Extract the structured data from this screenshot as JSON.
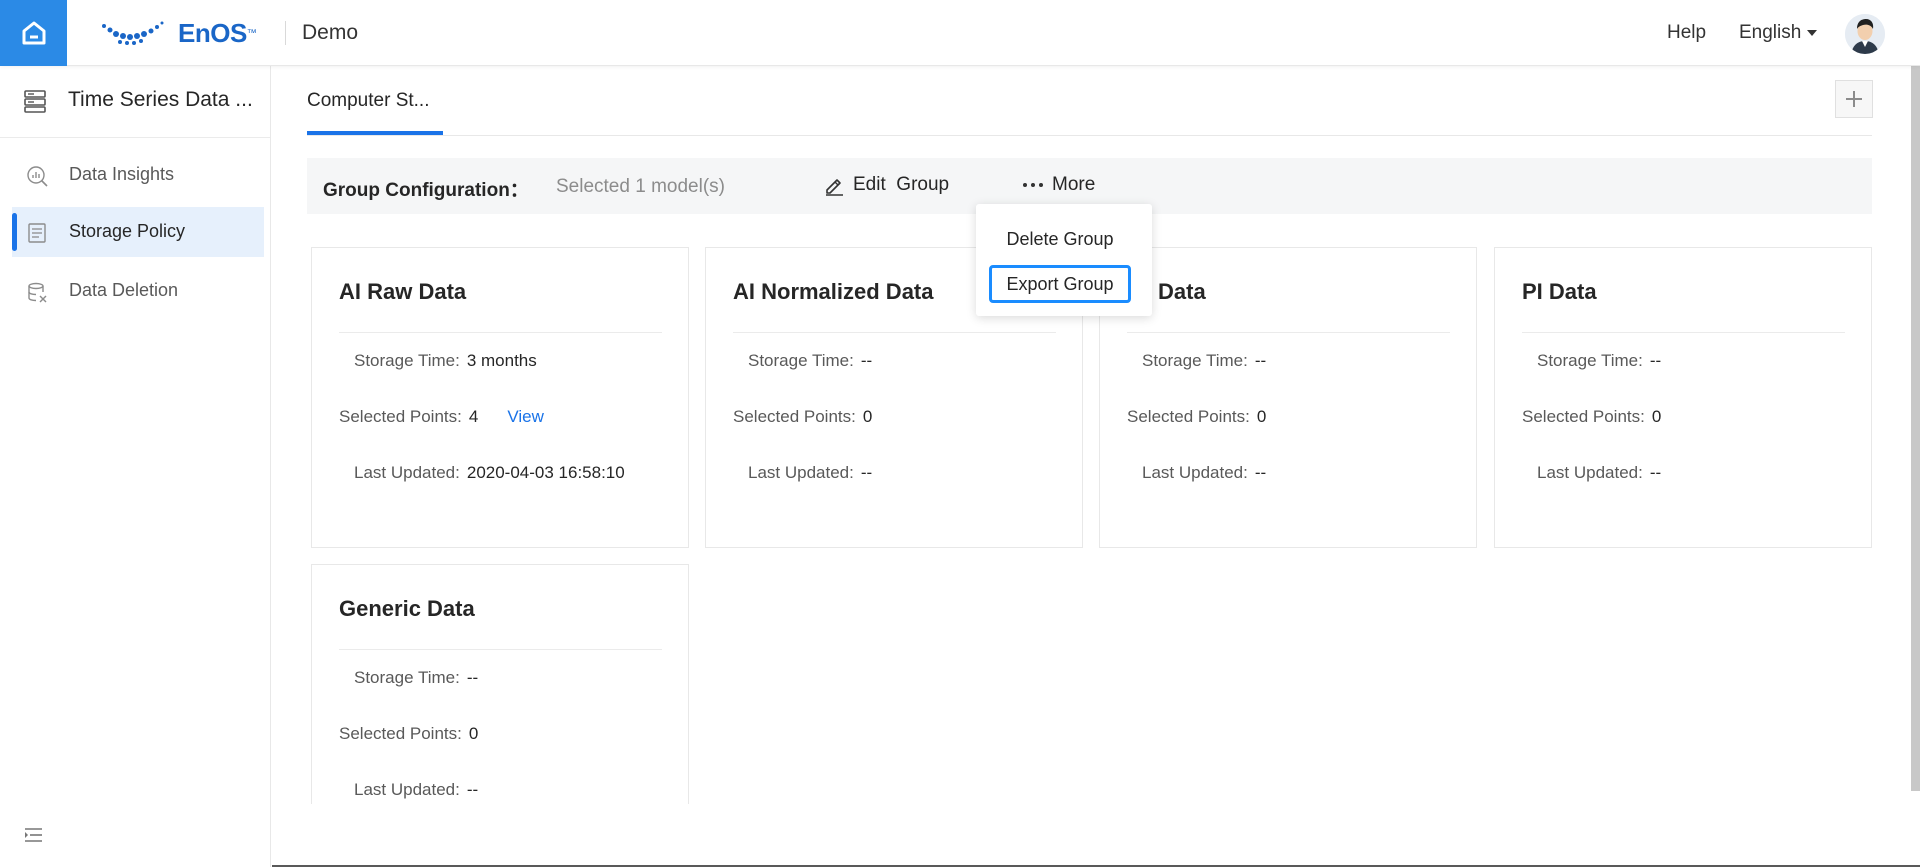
{
  "header": {
    "logo_text": "EnOS",
    "logo_tm": "™",
    "org_name": "Demo",
    "help_label": "Help",
    "language_label": "English"
  },
  "sidebar": {
    "title": "Time Series Data ...",
    "items": [
      {
        "label": "Data Insights",
        "icon": "chart-magnifier-icon",
        "active": false
      },
      {
        "label": "Storage Policy",
        "icon": "list-doc-icon",
        "active": true
      },
      {
        "label": "Data Deletion",
        "icon": "database-delete-icon",
        "active": false
      }
    ]
  },
  "tabs": [
    {
      "label": "Computer St...",
      "active": true
    }
  ],
  "group_bar": {
    "label": "Group Configuration：",
    "selected_text": "Selected 1 model(s)",
    "edit_label": "Edit  Group",
    "more_label": "More"
  },
  "dropdown": {
    "items": [
      "Delete Group",
      "Export Group"
    ]
  },
  "cards": [
    {
      "title": "AI Raw Data",
      "storage_time_label": "Storage Time:",
      "storage_time": "3 months",
      "points_label": "Selected Points:",
      "points": "4",
      "view_label": "View",
      "updated_label": "Last Updated:",
      "updated": "2020-04-03 16:58:10"
    },
    {
      "title": "AI Normalized Data",
      "storage_time_label": "Storage Time:",
      "storage_time": "--",
      "points_label": "Selected Points:",
      "points": "0",
      "updated_label": "Last Updated:",
      "updated": "--"
    },
    {
      "title": "Data",
      "storage_time_label": "Storage Time:",
      "storage_time": "--",
      "points_label": "Selected Points:",
      "points": "0",
      "updated_label": "Last Updated:",
      "updated": "--"
    },
    {
      "title": "PI Data",
      "storage_time_label": "Storage Time:",
      "storage_time": "--",
      "points_label": "Selected Points:",
      "points": "0",
      "updated_label": "Last Updated:",
      "updated": "--"
    },
    {
      "title": "Generic Data",
      "storage_time_label": "Storage Time:",
      "storage_time": "--",
      "points_label": "Selected Points:",
      "points": "0",
      "updated_label": "Last Updated:",
      "updated": "--"
    }
  ],
  "colors": {
    "primary": "#1a73e8",
    "home_button": "#2b8ae6",
    "active_nav_bg": "#e6f0fc",
    "focus_ring": "#1a8cff"
  }
}
